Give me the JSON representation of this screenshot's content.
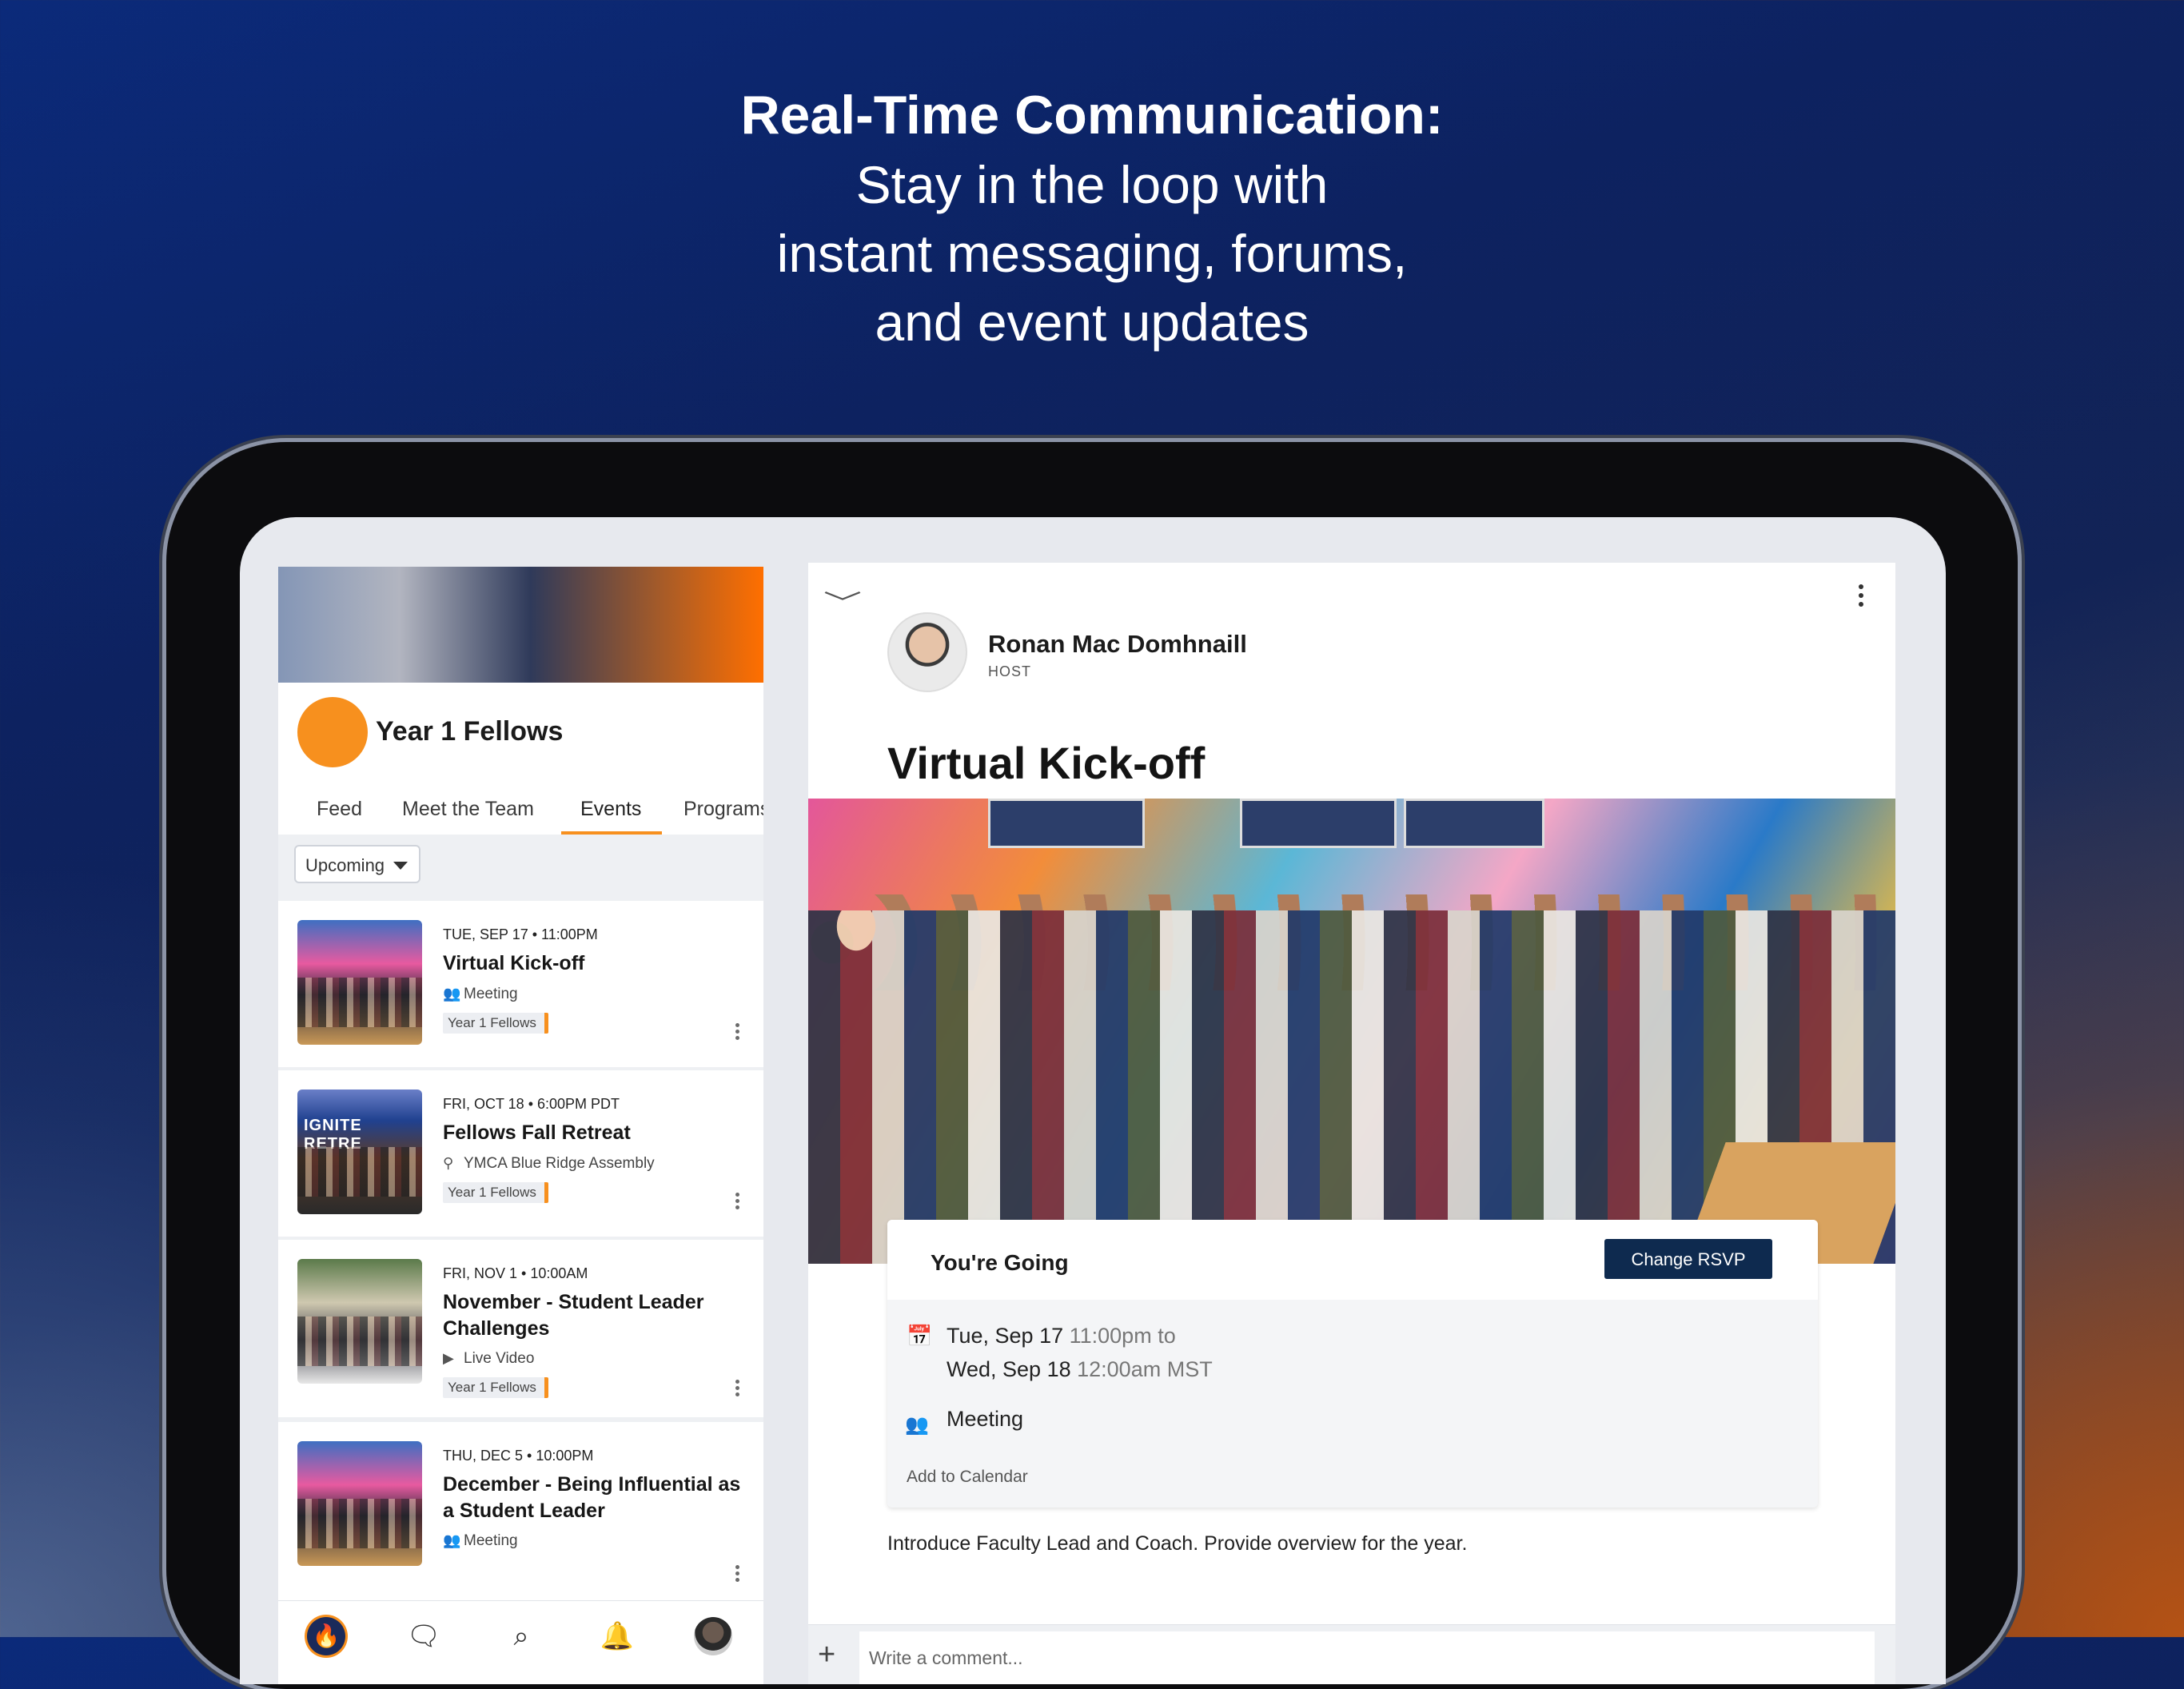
{
  "headline": {
    "title": "Real-Time Communication:",
    "line1": "Stay in the loop with",
    "line2": "instant messaging, forums,",
    "line3": "and event updates"
  },
  "group": {
    "name": "Year 1 Fellows",
    "logo_color": "#f7901e",
    "tabs": [
      {
        "label": "Feed"
      },
      {
        "label": "Meet the Team"
      },
      {
        "label": "Events",
        "active": true
      },
      {
        "label": "Programs"
      }
    ],
    "filter": "Upcoming"
  },
  "events": [
    {
      "date": "TUE, SEP 17 • 11:00PM",
      "title": "Virtual Kick-off",
      "meta_icon": "people-icon",
      "meta": "Meeting",
      "tag": "Year 1 Fellows"
    },
    {
      "date": "FRI, OCT 18 • 6:00PM PDT",
      "title": "Fellows Fall Retreat",
      "meta_icon": "location-pin-icon",
      "meta": "YMCA Blue Ridge Assembly",
      "tag": "Year 1 Fellows",
      "thumb_text": "IGNITE RETRE"
    },
    {
      "date": "FRI, NOV 1 • 10:00AM",
      "title": "November  - Student Leader Challenges",
      "meta_icon": "play-icon",
      "meta": "Live Video",
      "tag": "Year 1 Fellows"
    },
    {
      "date": "THU, DEC 5 • 10:00PM",
      "title": "December - Being Influential as a Student Leader",
      "meta_icon": "people-icon",
      "meta": "Meeting"
    }
  ],
  "nav": {
    "items": [
      "home-icon",
      "chat-icon",
      "search-icon",
      "bell-icon",
      "avatar"
    ]
  },
  "detail": {
    "host_name": "Ronan Mac Domhnaill",
    "host_role": "HOST",
    "title": "Virtual Kick-off",
    "rsvp_status": "You're Going",
    "rsvp_button": "Change RSVP",
    "start_day": "Tue, Sep 17",
    "start_time": "11:00pm to",
    "end_day": "Wed, Sep 18",
    "end_time": "12:00am MST",
    "type": "Meeting",
    "add_calendar": "Add to Calendar",
    "description": "Introduce Faculty Lead and Coach. Provide overview for the year.",
    "comment_placeholder": "Write a comment..."
  },
  "colors": {
    "accent": "#f7901e",
    "primary_button": "#0e2a4f"
  }
}
